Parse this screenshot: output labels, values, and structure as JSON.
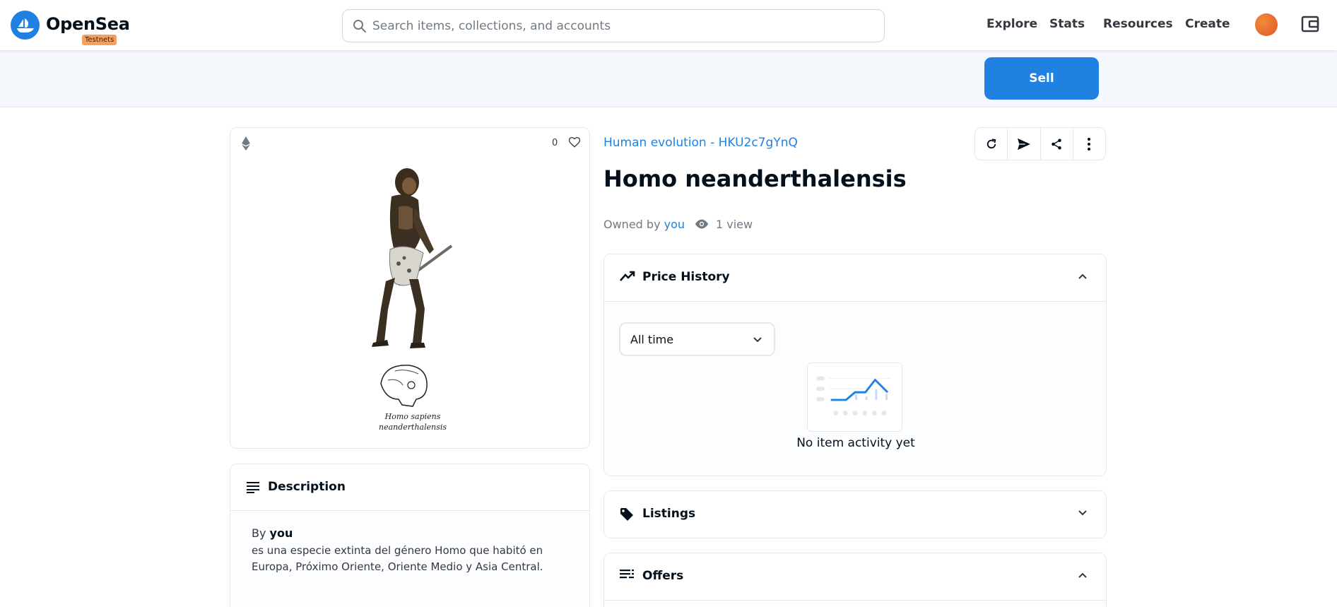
{
  "header": {
    "brand": "OpenSea",
    "badge": "Testnets",
    "search_placeholder": "Search items, collections, and accounts",
    "nav": [
      "Explore",
      "Stats",
      "Resources",
      "Create"
    ]
  },
  "sell_bar": {
    "sell_label": "Sell"
  },
  "asset": {
    "favorites_count": "0",
    "artwork_caption_line1": "Homo sapiens",
    "artwork_caption_line2": "neanderthalensis",
    "collection": "Human evolution - HKU2c7gYnQ",
    "title": "Homo neanderthalensis",
    "owned_by_label": "Owned by",
    "owner": "you",
    "views": "1 view"
  },
  "description": {
    "title": "Description",
    "by_label": "By",
    "by_name": "you",
    "text": "es una especie extinta del género Homo que habitó en Europa, Próximo Oriente, Oriente Medio y Asia Central."
  },
  "price_history": {
    "title": "Price History",
    "range": "All time",
    "empty": "No item activity yet"
  },
  "listings": {
    "title": "Listings"
  },
  "offers": {
    "title": "Offers"
  },
  "colors": {
    "accent": "#2081e2",
    "badge": "#f5a05f"
  }
}
